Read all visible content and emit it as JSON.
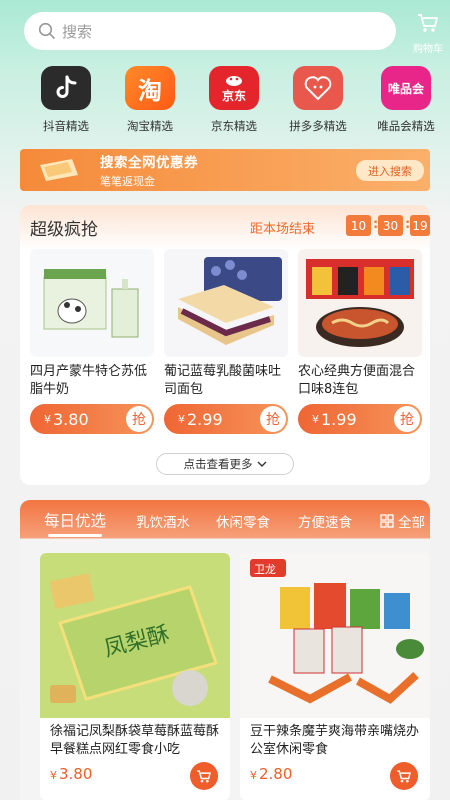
{
  "search": {
    "placeholder": "搜索"
  },
  "cart": {
    "label": "购物车"
  },
  "platforms": [
    {
      "name": "抖音精选",
      "icon": "douyin-icon",
      "color": "#2b2b2b"
    },
    {
      "name": "淘宝精选",
      "icon": "taobao-icon",
      "color": "#ff6a1a",
      "glyph": "淘"
    },
    {
      "name": "京东精选",
      "icon": "jd-icon",
      "color": "#e4262c",
      "glyph": "京东"
    },
    {
      "name": "拼多多精选",
      "icon": "pinduoduo-icon",
      "color": "#e9584c"
    },
    {
      "name": "唯品会精选",
      "icon": "vipshop-icon",
      "color": "#e8268a",
      "glyph": "唯品会"
    }
  ],
  "coupon": {
    "title": "搜索全网优惠券",
    "subtitle": "笔笔返现金",
    "button": "进入搜索"
  },
  "flash_sale": {
    "title": "超级疯抢",
    "countdown_label": "距本场结束",
    "countdown": [
      "10",
      "30",
      "19"
    ],
    "more": "点击查看更多",
    "grab_label": "抢",
    "products": [
      {
        "name": "四月产蒙牛特仑苏低脂牛奶",
        "currency": "¥",
        "price": "3.80"
      },
      {
        "name": "葡记蓝莓乳酸菌味吐司面包",
        "currency": "¥",
        "price": "2.99"
      },
      {
        "name": "农心经典方便面混合口味8连包",
        "currency": "¥",
        "price": "1.99"
      }
    ]
  },
  "daily": {
    "tabs": [
      "每日优选",
      "乳饮酒水",
      "休闲零食",
      "方便速食"
    ],
    "all_label": "全部",
    "items": [
      {
        "name": "徐福记凤梨酥袋草莓酥蓝莓酥早餐糕点网红零食小吃",
        "currency": "¥",
        "price": "3.80",
        "img_text": "凤梨酥"
      },
      {
        "name": "豆干辣条魔芋爽海带亲嘴烧办公室休闲零食",
        "currency": "¥",
        "price": "2.80",
        "img_text": "卫龙"
      }
    ]
  },
  "colors": {
    "accent": "#ef6634",
    "header_top": "#a9e9d3"
  }
}
